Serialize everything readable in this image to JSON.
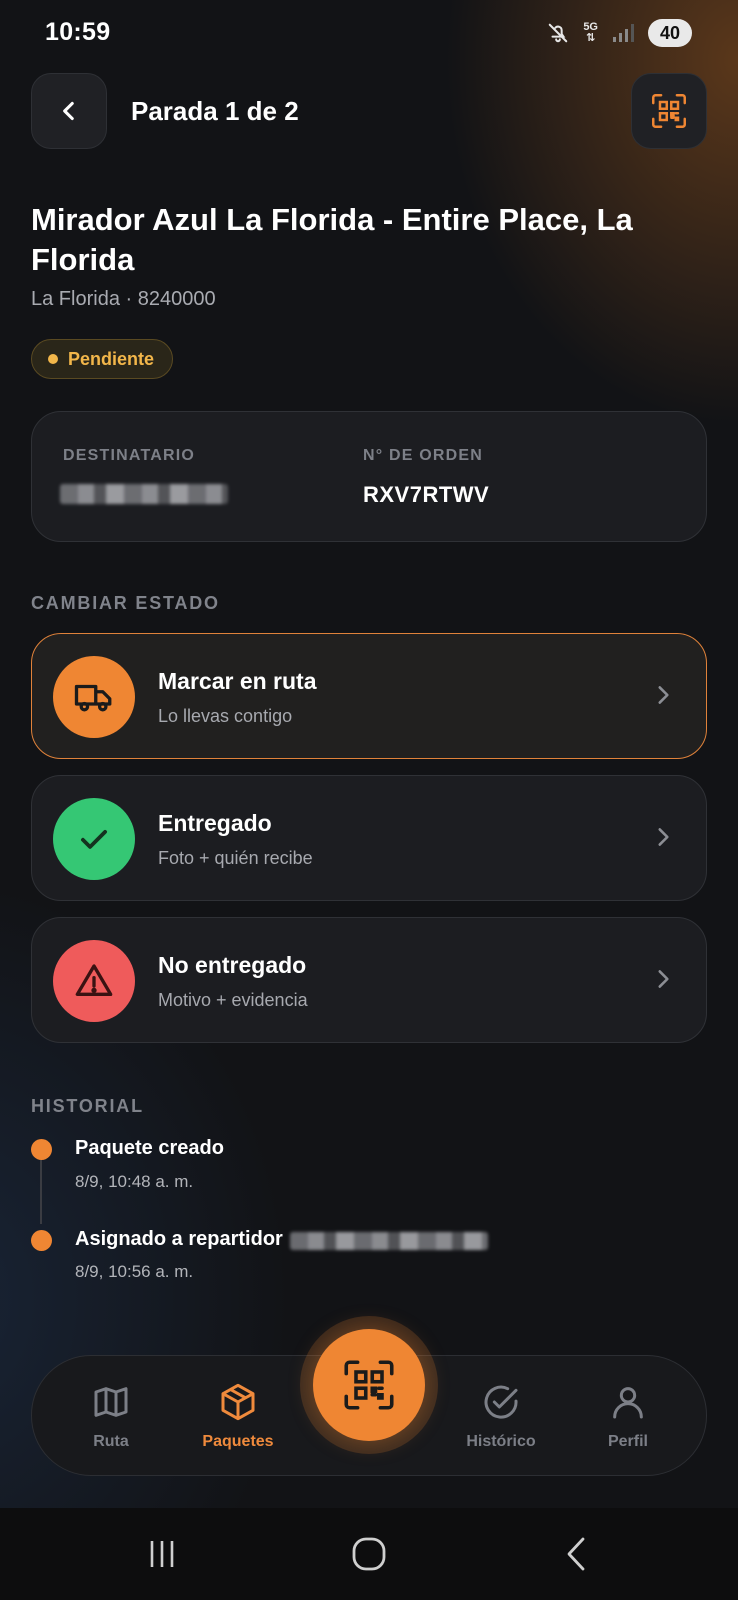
{
  "status_bar": {
    "time": "10:59",
    "network": "5G",
    "battery": "40"
  },
  "header": {
    "title": "Parada 1 de 2"
  },
  "stop": {
    "name": "Mirador Azul La Florida - Entire Place, La Florida",
    "subtitle": "La Florida · 8240000",
    "status": "Pendiente"
  },
  "info": {
    "recipient_label": "DESTINATARIO",
    "order_label": "N° DE ORDEN",
    "order_value": "RXV7RTWV"
  },
  "change_status": {
    "section_label": "CAMBIAR ESTADO",
    "actions": [
      {
        "title": "Marcar en ruta",
        "subtitle": "Lo llevas contigo",
        "color": "#ef8633"
      },
      {
        "title": "Entregado",
        "subtitle": "Foto + quién recibe",
        "color": "#35c774"
      },
      {
        "title": "No entregado",
        "subtitle": "Motivo + evidencia",
        "color": "#ef5b5b"
      }
    ]
  },
  "history": {
    "section_label": "HISTORIAL",
    "events": [
      {
        "title": "Paquete creado",
        "time": "8/9, 10:48 a. m."
      },
      {
        "title": "Asignado a repartidor",
        "time": "8/9, 10:56 a. m."
      }
    ]
  },
  "bottom_nav": {
    "items": [
      {
        "label": "Ruta",
        "icon": "map-icon"
      },
      {
        "label": "Paquetes",
        "icon": "package-icon",
        "selected": true
      },
      {
        "label": "Histórico",
        "icon": "check-circle-icon"
      },
      {
        "label": "Perfil",
        "icon": "user-icon"
      }
    ]
  },
  "colors": {
    "accent": "#ef8633",
    "success": "#35c774",
    "danger": "#ef5b5b",
    "pending": "#f2b64a"
  }
}
